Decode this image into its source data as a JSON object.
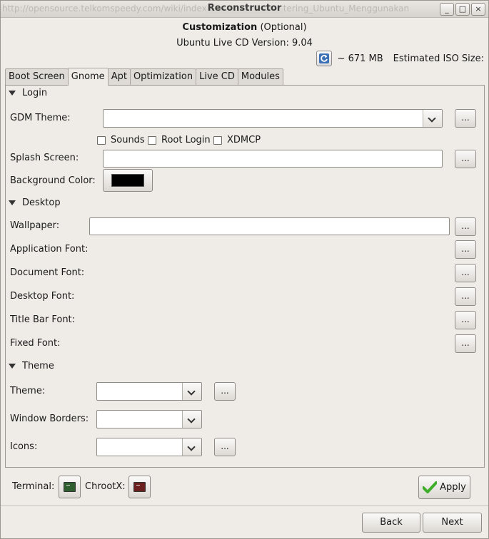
{
  "window": {
    "title": "Reconstructor",
    "ghost_url": "http://opensource.telkomspeedy.com/wiki/index.php?title=Remastering_Ubuntu_Menggunakan",
    "controls": [
      "_",
      "□",
      "×"
    ]
  },
  "header": {
    "title_bold": "Customization",
    "title_suffix": "(Optional)",
    "version_line": "Ubuntu Live CD Version: 9.04",
    "iso_size_value": "~ 671 MB",
    "iso_size_label": "Estimated ISO Size:"
  },
  "tabs": [
    {
      "label": "Boot Screen"
    },
    {
      "label": "Gnome"
    },
    {
      "label": "Apt"
    },
    {
      "label": "Optimization"
    },
    {
      "label": "Live CD"
    },
    {
      "label": "Modules"
    }
  ],
  "active_tab": "Gnome",
  "login": {
    "section": "Login",
    "gdm_theme_label": "GDM Theme:",
    "gdm_theme_value": "",
    "sounds_label": "Sounds",
    "sounds_checked": false,
    "root_login_label": "Root Login",
    "root_login_checked": false,
    "xdmcp_label": "XDMCP",
    "xdmcp_checked": false,
    "splash_label": "Splash Screen:",
    "splash_value": "",
    "bg_color_label": "Background Color:",
    "bg_color": "#000000"
  },
  "desktop": {
    "section": "Desktop",
    "wallpaper_label": "Wallpaper:",
    "wallpaper_value": "",
    "app_font_label": "Application Font:",
    "doc_font_label": "Document Font:",
    "desktop_font_label": "Desktop Font:",
    "titlebar_font_label": "Title Bar Font:",
    "fixed_font_label": "Fixed Font:"
  },
  "theme": {
    "section": "Theme",
    "theme_label": "Theme:",
    "window_borders_label": "Window Borders:",
    "icons_label": "Icons:"
  },
  "browse_label": "...",
  "footer": {
    "terminal_label": "Terminal:",
    "chrootx_label": "ChrootX:",
    "apply_label": "Apply",
    "back_label": "Back",
    "next_label": "Next"
  },
  "colors": {
    "window_bg": "#efebe7",
    "apply_check": "#3fae2a",
    "terminal_icon": "#2f5f2f",
    "chrootx_icon": "#6b1f1f"
  }
}
